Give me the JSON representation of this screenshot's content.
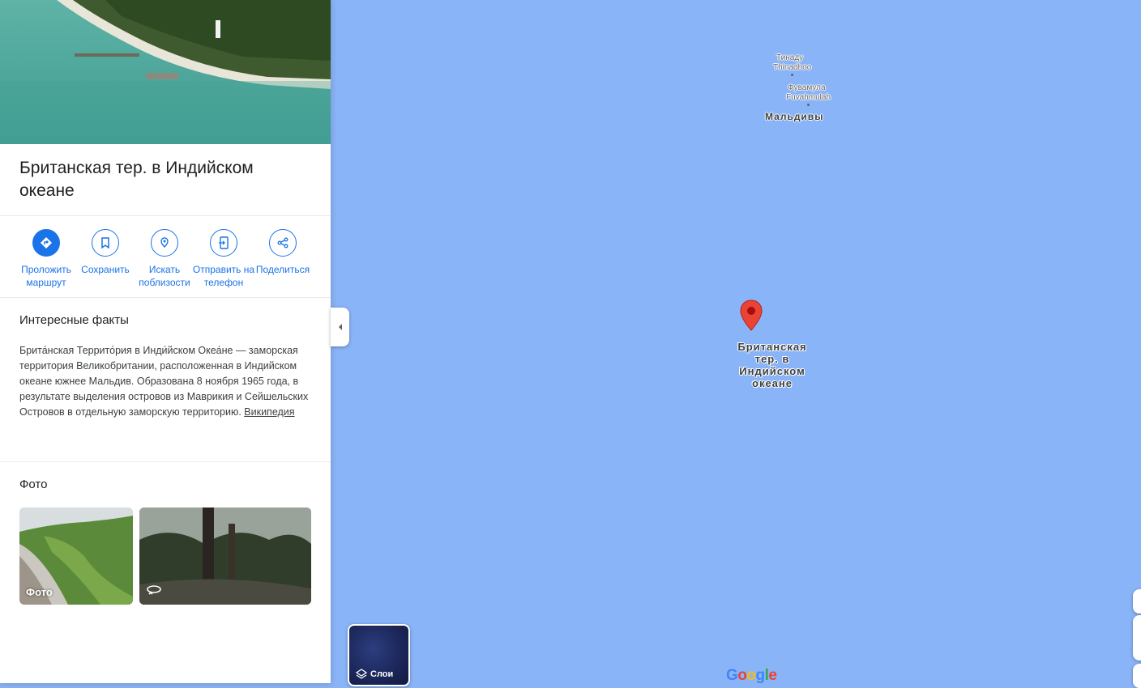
{
  "place": {
    "title": "Британская тер. в Индийском океане"
  },
  "actions": [
    {
      "label": "Проложить маршрут",
      "icon": "directions-icon"
    },
    {
      "label": "Сохранить",
      "icon": "bookmark-icon"
    },
    {
      "label": "Искать поблизости",
      "icon": "nearby-icon"
    },
    {
      "label": "Отправить на телефон",
      "icon": "send-to-phone-icon"
    },
    {
      "label": "Поделиться",
      "icon": "share-icon"
    }
  ],
  "facts": {
    "heading": "Интересные факты",
    "text": "Брита́нская Террито́рия в Инди́йском Океа́не — заморская территория Великобритании, расположенная в Индийском океане южнее Мальдив. Образована 8 ноября 1965 года, в результате выделения островов из Маврикия и Сейшельских Островов в отдельную заморскую территорию.",
    "source_link": "Википедия"
  },
  "photos": {
    "heading": "Фото",
    "items": [
      {
        "caption": "Фото"
      },
      {
        "caption": "",
        "icon": "360-icon"
      }
    ]
  },
  "map": {
    "labels": {
      "thinadhoo_ru": "Тинаду",
      "thinadhoo_en": "Thinadhoo",
      "fuvahmulah_ru": "Фувамула",
      "fuvahmulah_en": "Fuvahmulah",
      "maldives": "Мальдивы",
      "pin": "Британская тер. в Индийском океане"
    },
    "layers_label": "Слои",
    "logo": "Google"
  },
  "colors": {
    "water": "#8ab4f8",
    "accent": "#1a73e8",
    "pin": "#ea4335"
  }
}
